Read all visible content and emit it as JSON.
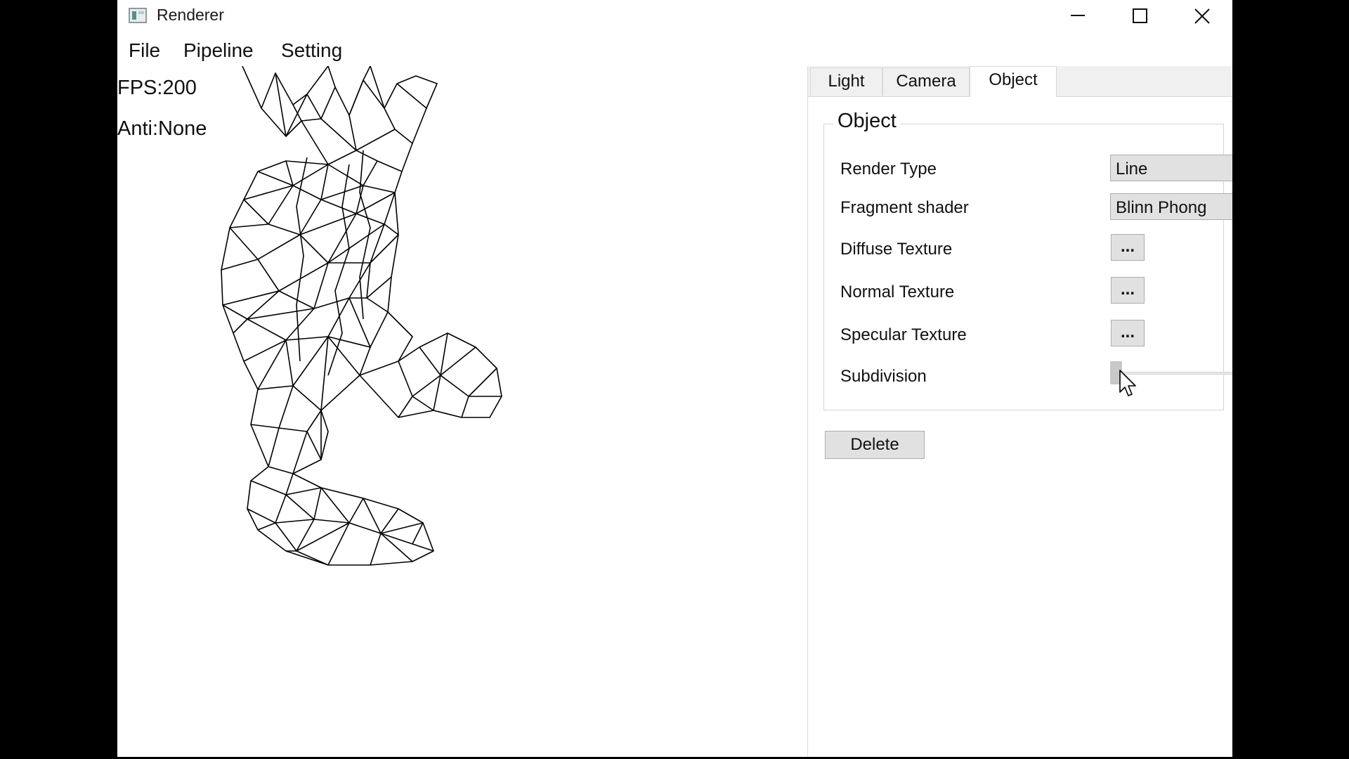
{
  "window": {
    "title": "Renderer",
    "icon": "app-window-icon",
    "controls": [
      "minimize-icon",
      "maximize-icon",
      "close-icon"
    ]
  },
  "menu": {
    "items": [
      {
        "label": "File"
      },
      {
        "label": "Pipeline"
      },
      {
        "label": "Setting"
      }
    ]
  },
  "viewport": {
    "fps": "FPS:200",
    "anti": "Anti:None"
  },
  "tabs": [
    {
      "label": "Light",
      "active": false
    },
    {
      "label": "Camera",
      "active": false
    },
    {
      "label": "Object",
      "active": true
    }
  ],
  "object_panel": {
    "group_title": "Object",
    "render_type": {
      "label": "Render Type",
      "value": "Line"
    },
    "fragment_shader": {
      "label": "Fragment shader",
      "value": "Blinn Phong"
    },
    "diffuse_texture": {
      "label": "Diffuse Texture",
      "button": "..."
    },
    "normal_texture": {
      "label": "Normal Texture",
      "button": "..."
    },
    "specular_texture": {
      "label": "Specular Texture",
      "button": "..."
    },
    "subdivision": {
      "label": "Subdivision",
      "value_fraction": 0.0
    },
    "delete_label": "Delete"
  },
  "colors": {
    "window_bg": "#ffffff",
    "screen_bg": "#000000",
    "button_bg": "#e1e1e1",
    "mesh_line": "#000000"
  }
}
